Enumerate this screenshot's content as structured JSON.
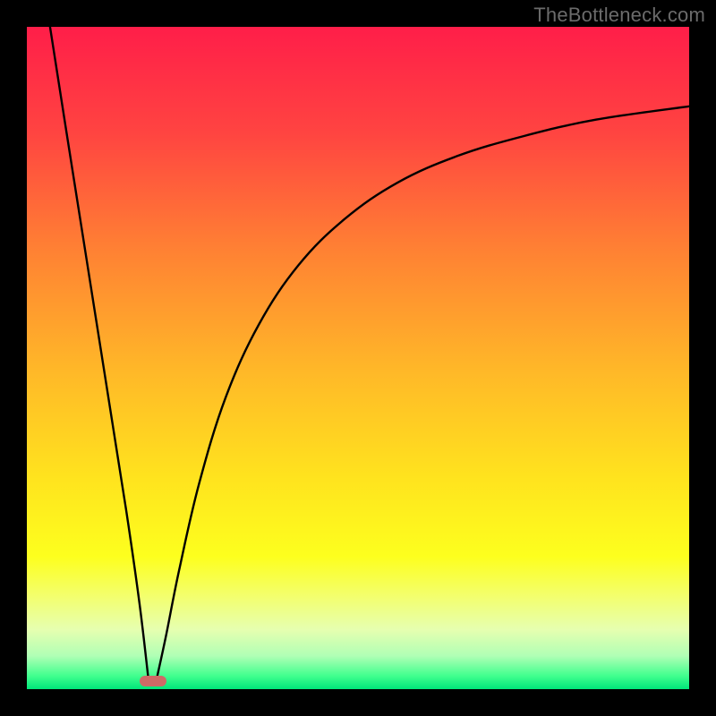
{
  "watermark": "TheBottleneck.com",
  "colors": {
    "marker": "#cf6a66",
    "curve": "#000000",
    "gradient_stops": [
      {
        "pct": 0,
        "color": "#ff1e49"
      },
      {
        "pct": 16,
        "color": "#ff4441"
      },
      {
        "pct": 34,
        "color": "#ff8233"
      },
      {
        "pct": 52,
        "color": "#ffb828"
      },
      {
        "pct": 68,
        "color": "#ffe31e"
      },
      {
        "pct": 80,
        "color": "#fdff1e"
      },
      {
        "pct": 86,
        "color": "#f3ff6e"
      },
      {
        "pct": 91,
        "color": "#e6ffb0"
      },
      {
        "pct": 95,
        "color": "#b0ffb5"
      },
      {
        "pct": 98,
        "color": "#41ff8e"
      },
      {
        "pct": 100,
        "color": "#00e67a"
      }
    ]
  },
  "chart_data": {
    "type": "line",
    "title": "",
    "xlabel": "",
    "ylabel": "",
    "xlim": [
      0,
      100
    ],
    "ylim": [
      0,
      100
    ],
    "marker": {
      "x": 19,
      "y": 1.2
    },
    "series": [
      {
        "name": "left-branch",
        "x": [
          3.5,
          6,
          9,
          12,
          15,
          17,
          18.3
        ],
        "values": [
          100,
          84,
          65,
          46,
          27,
          13,
          2
        ]
      },
      {
        "name": "right-branch",
        "x": [
          19.7,
          21,
          23,
          26,
          30,
          35,
          41,
          48,
          56,
          65,
          75,
          86,
          100
        ],
        "values": [
          2,
          8,
          18,
          31,
          44,
          55,
          64,
          71,
          76.5,
          80.5,
          83.5,
          86,
          88
        ]
      }
    ]
  }
}
